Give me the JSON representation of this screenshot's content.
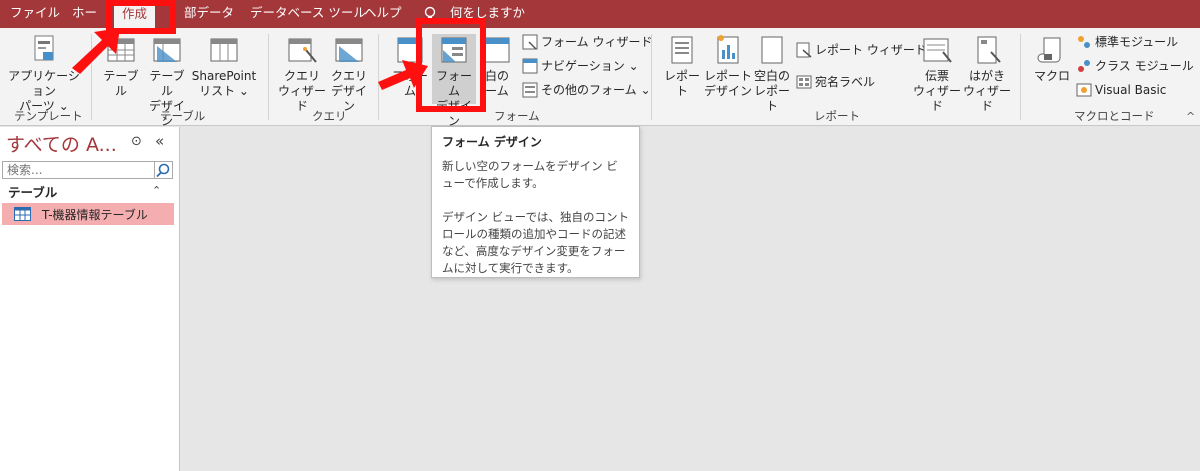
{
  "menubar": {
    "tabs": [
      {
        "label": "ファイル"
      },
      {
        "label": "ホー"
      },
      {
        "label": "作成"
      },
      {
        "label": "部データ"
      },
      {
        "label": "データベース ツール"
      },
      {
        "label": "ヘルプ"
      }
    ],
    "tellme": "何をしますか"
  },
  "ribbon": {
    "template": {
      "app_parts": "アプリケーション\nパーツ ⌄",
      "group": "テンプレート"
    },
    "tables": {
      "table": "テーブル",
      "table_design": "テーブル\nデザイン",
      "sharepoint": "SharePoint\nリスト ⌄",
      "group": "テーブル"
    },
    "query": {
      "wizard": "クエリ\nウィザード",
      "design": "クエリ\nデザイン",
      "group": "クエリ"
    },
    "forms": {
      "form": "フォーム",
      "form_design": "フォーム\nデザイン",
      "blank_form": "白の\nーム",
      "form_wizard": "フォーム ウィザード",
      "navigation": "ナビゲーション ⌄",
      "more_forms": "その他のフォーム ⌄",
      "group": "フォーム"
    },
    "reports": {
      "report": "レポート",
      "report_design": "レポート\nデザイン",
      "blank_report": "空白の\nレポート",
      "report_wizard": "レポート ウィザード",
      "labels": "宛名ラベル",
      "slip_wizard": "伝票\nウィザード",
      "postcard_wizard": "はがき\nウィザード",
      "group": "レポート"
    },
    "macros": {
      "macro": "マクロ",
      "module": "標準モジュール",
      "class_module": "クラス モジュール",
      "vba": "Visual Basic",
      "group": "マクロとコード"
    }
  },
  "nav": {
    "title": "すべての A...",
    "collapse": "«",
    "dropdown": "⊙",
    "search_placeholder": "検索...",
    "group": "テーブル",
    "group_toggle": "⌃",
    "items": [
      {
        "label": "T-機器情報テーブル"
      }
    ]
  },
  "tooltip": {
    "title": "フォーム デザイン",
    "p1": "新しい空のフォームをデザイン ビューで作成します。",
    "p2": "デザイン ビューでは、独自のコントロールの種類の追加やコードの記述など、高度なデザイン変更をフォームに対して実行できます。"
  },
  "colors": {
    "accent": "#a4373a",
    "highlight": "#ff1010",
    "nav_selected": "#f4aeb0"
  }
}
